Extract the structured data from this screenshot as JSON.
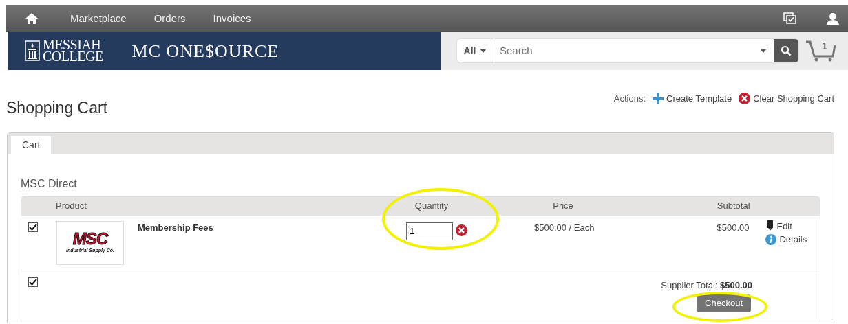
{
  "top_nav": {
    "items": [
      "Marketplace",
      "Orders",
      "Invoices"
    ]
  },
  "header": {
    "logo_lines": [
      "MESSIAH",
      "COLLEGE"
    ],
    "site_title": "MC ONE$OURCE",
    "search_scope": "All",
    "search_placeholder": "Search",
    "cart_count": "1"
  },
  "page": {
    "title": "Shopping Cart",
    "actions_label": "Actions:",
    "actions": [
      {
        "kind": "add",
        "label": "Create Template"
      },
      {
        "kind": "clear",
        "label": "Clear Shopping Cart"
      }
    ]
  },
  "tabs": [
    {
      "label": "Cart",
      "selected": true
    }
  ],
  "supplier": {
    "name": "MSC Direct",
    "columns": [
      "Product",
      "Quantity",
      "Price",
      "Subtotal"
    ],
    "items": [
      {
        "checked": true,
        "logo_text": "MSC",
        "logo_tagline": "Industrial Supply Co.",
        "name": "Membership Fees",
        "quantity": "1",
        "quantity_highlighted": true,
        "price": "$500.00 / Each",
        "subtotal": "$500.00",
        "links": [
          {
            "kind": "edit",
            "label": "Edit"
          },
          {
            "kind": "details",
            "label": "Details"
          }
        ]
      }
    ],
    "footer_checked": true,
    "total_label": "Supplier Total:",
    "total_value": "$500.00",
    "checkout": {
      "label": "Checkout",
      "highlighted": true
    }
  }
}
